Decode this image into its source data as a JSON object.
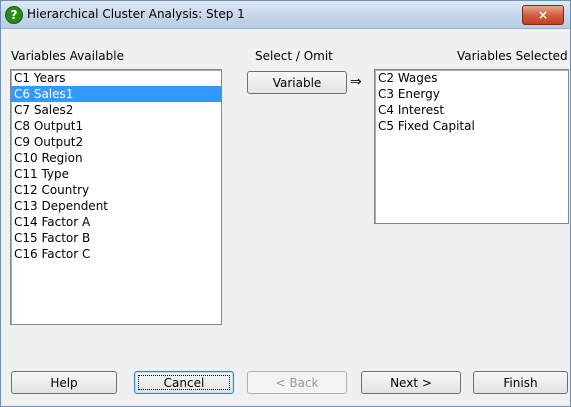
{
  "window": {
    "title": "Hierarchical Cluster Analysis: Step 1",
    "close_label": "×"
  },
  "left_panel": {
    "label": "Variables Available",
    "items": [
      {
        "text": "C1 Years",
        "selected": false
      },
      {
        "text": "C6 Sales1",
        "selected": true
      },
      {
        "text": "C7 Sales2",
        "selected": false
      },
      {
        "text": "C8 Output1",
        "selected": false
      },
      {
        "text": "C9 Output2",
        "selected": false
      },
      {
        "text": "C10 Region",
        "selected": false
      },
      {
        "text": "C11 Type",
        "selected": false
      },
      {
        "text": "C12 Country",
        "selected": false
      },
      {
        "text": "C13 Dependent",
        "selected": false
      },
      {
        "text": "C14 Factor A",
        "selected": false
      },
      {
        "text": "C15 Factor B",
        "selected": false
      },
      {
        "text": "C16 Factor C",
        "selected": false
      }
    ]
  },
  "middle": {
    "label": "Select / Omit",
    "variable_button": "Variable",
    "arrow": "⇒"
  },
  "right_panel": {
    "label": "Variables Selected",
    "items": [
      {
        "text": "C2 Wages"
      },
      {
        "text": "C3 Energy"
      },
      {
        "text": "C4 Interest"
      },
      {
        "text": "C5 Fixed Capital"
      }
    ]
  },
  "buttons": {
    "help": "Help",
    "cancel": "Cancel",
    "back": "< Back",
    "next": "Next >",
    "finish": "Finish"
  }
}
